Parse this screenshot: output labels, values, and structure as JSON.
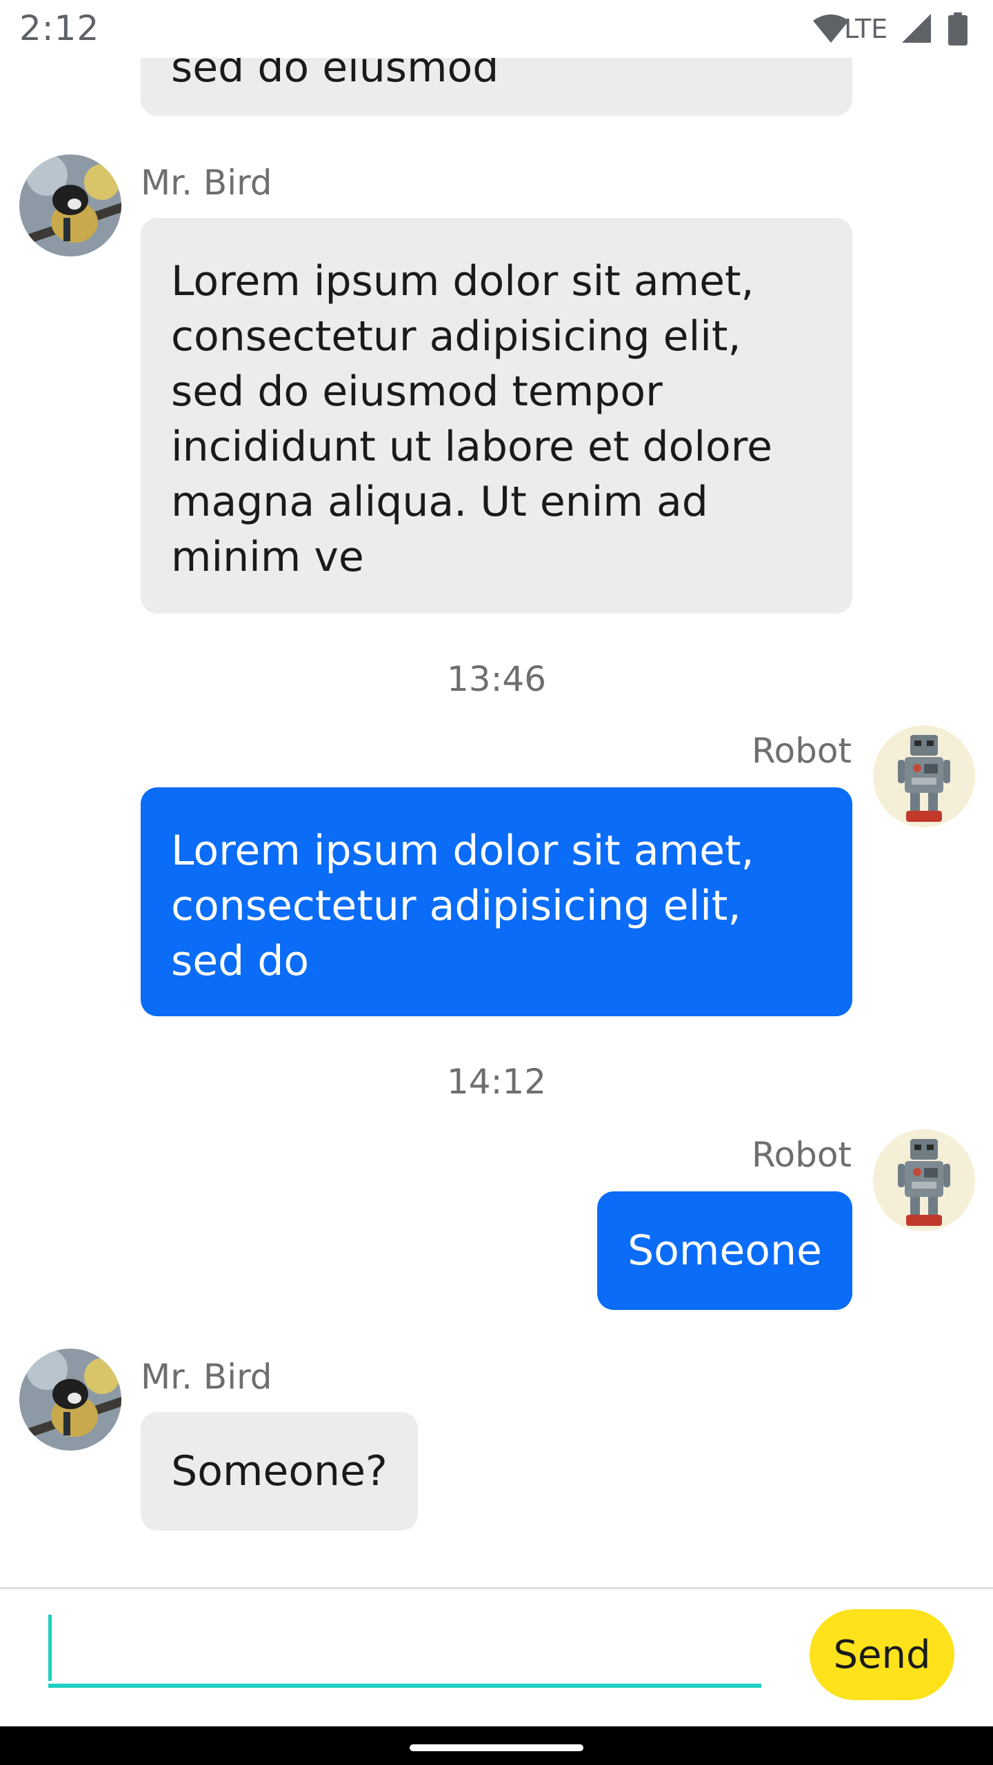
{
  "status_bar": {
    "time": "2:12",
    "network": "LTE",
    "icons": [
      "wifi-icon",
      "signal-icon",
      "battery-icon"
    ]
  },
  "colors": {
    "incoming_bubble": "#ececec",
    "outgoing_bubble": "#0a6cf7",
    "send_button": "#fde21c",
    "input_accent": "#1ccfc0"
  },
  "messages": [
    {
      "id": "m0",
      "direction": "incoming",
      "text": "sed do eiusmod"
    },
    {
      "id": "m1",
      "direction": "incoming",
      "sender": "Mr. Bird",
      "text": "Lorem ipsum dolor sit amet,\nconsectetur adipisicing elit,\nsed do eiusmod tempor\nincididunt ut labore et dolore\nmagna aliqua. Ut enim ad\nminim ve"
    },
    {
      "id": "t1",
      "type": "timestamp",
      "text": "13:46"
    },
    {
      "id": "m2",
      "direction": "outgoing",
      "sender": "Robot",
      "text": "Lorem ipsum dolor sit amet,\nconsectetur adipisicing elit,\nsed do"
    },
    {
      "id": "t2",
      "type": "timestamp",
      "text": "14:12"
    },
    {
      "id": "m3",
      "direction": "outgoing",
      "sender": "Robot",
      "text": "Someone"
    },
    {
      "id": "m4",
      "direction": "incoming",
      "sender": "Mr. Bird",
      "text": "Someone?"
    }
  ],
  "composer": {
    "input_value": "",
    "send_label": "Send"
  }
}
